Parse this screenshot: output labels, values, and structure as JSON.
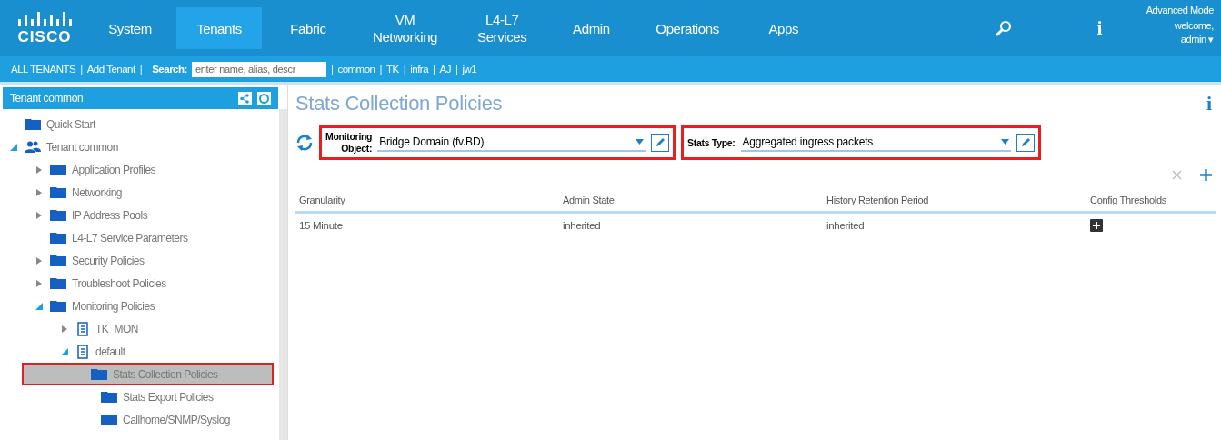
{
  "nav": {
    "logo_text": "CISCO",
    "tabs": [
      {
        "label": "System",
        "selected": false
      },
      {
        "label": "Tenants",
        "selected": true
      },
      {
        "label": "Fabric",
        "selected": false
      },
      {
        "label": "VM\nNetworking",
        "selected": false
      },
      {
        "label": "L4-L7\nServices",
        "selected": false
      },
      {
        "label": "Admin",
        "selected": false
      },
      {
        "label": "Operations",
        "selected": false
      },
      {
        "label": "Apps",
        "selected": false
      }
    ],
    "info": "i",
    "user": {
      "mode": "Advanced Mode",
      "welcome": "welcome,",
      "name": "admin",
      "caret": "▾"
    }
  },
  "subnav": {
    "separator": "|",
    "links_before": [
      "ALL TENANTS",
      "Add Tenant"
    ],
    "search_label": "Search:",
    "search_placeholder": "enter name, alias, descr",
    "tenants": [
      "common",
      "TK",
      "infra",
      "AJ",
      "jw1"
    ]
  },
  "sidebar": {
    "title": "Tenant common",
    "tree": [
      {
        "label": "Quick Start",
        "kind": "folder",
        "selected": false
      },
      {
        "label": "Tenant common",
        "kind": "tenant",
        "expanded": true,
        "selected": false,
        "children": [
          {
            "label": "Application Profiles",
            "kind": "folder",
            "expanded": false,
            "selected": false
          },
          {
            "label": "Networking",
            "kind": "folder",
            "expanded": false,
            "selected": false
          },
          {
            "label": "IP Address Pools",
            "kind": "folder",
            "expanded": false,
            "selected": false
          },
          {
            "label": "L4-L7 Service Parameters",
            "kind": "folder",
            "selected": false
          },
          {
            "label": "Security Policies",
            "kind": "folder",
            "expanded": false,
            "selected": false
          },
          {
            "label": "Troubleshoot Policies",
            "kind": "folder",
            "expanded": false,
            "selected": false
          },
          {
            "label": "Monitoring Policies",
            "kind": "folder",
            "expanded": true,
            "selected": false,
            "children": [
              {
                "label": "TK_MON",
                "kind": "policy",
                "expanded": false,
                "selected": false
              },
              {
                "label": "default",
                "kind": "policy",
                "expanded": true,
                "selected": false,
                "children": [
                  {
                    "label": "Stats Collection Policies",
                    "kind": "folder",
                    "selected": true
                  },
                  {
                    "label": "Stats Export Policies",
                    "kind": "folder",
                    "selected": false
                  },
                  {
                    "label": "Callhome/SNMP/Syslog",
                    "kind": "folder",
                    "selected": false
                  }
                ]
              }
            ]
          }
        ]
      }
    ]
  },
  "content": {
    "title": "Stats Collection Policies",
    "info": "i",
    "filters": [
      {
        "label": "Monitoring\nObject:",
        "value": "Bridge Domain (fv.BD)",
        "highlighted": true
      },
      {
        "label": "Stats Type:",
        "value": "Aggregated ingress packets",
        "highlighted": true
      }
    ],
    "table": {
      "columns": [
        "Granularity",
        "Admin State",
        "History Retention Period",
        "Config Thresholds"
      ],
      "rows": [
        {
          "granularity": "15 Minute",
          "admin_state": "inherited",
          "history_retention": "inherited"
        }
      ]
    }
  }
}
